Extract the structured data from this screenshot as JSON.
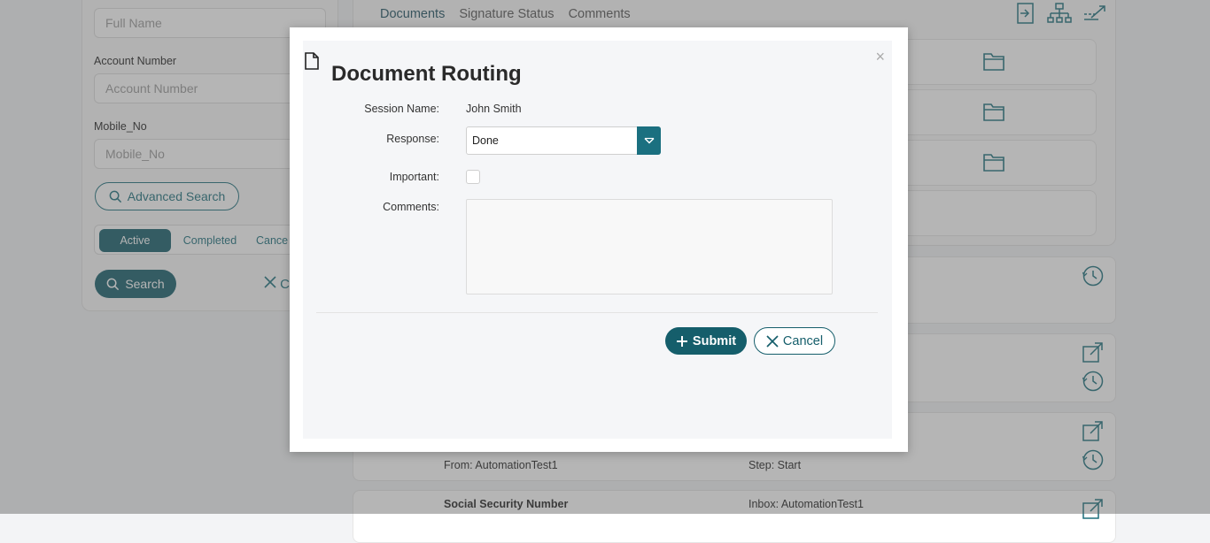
{
  "background": {
    "search_panel": {
      "full_name_placeholder": "Full Name",
      "account_number_label": "Account Number",
      "account_number_placeholder": "Account Number",
      "mobile_label": "Mobile_No",
      "mobile_placeholder": "Mobile_No",
      "advanced_search_label": "Advanced Search",
      "status_tabs": [
        "Active",
        "Completed",
        "Cance"
      ],
      "search_label": "Search",
      "clear_label": "C"
    },
    "tabs": [
      "Documents",
      "Signature Status",
      "Comments"
    ],
    "cards": {
      "from_text": "From: AutomationTest1",
      "step_text": "Step: Start",
      "ssn_text": "Social Security Number",
      "inbox_text": "Inbox: AutomationTest1"
    }
  },
  "modal": {
    "title": "Document Routing",
    "close_glyph": "×",
    "session_name_label": "Session Name:",
    "session_name_value": "John Smith",
    "response_label": "Response:",
    "response_value": "Done",
    "important_label": "Important:",
    "comments_label": "Comments:",
    "comments_value": "",
    "submit_label": "Submit",
    "cancel_label": "Cancel"
  },
  "colors": {
    "accent": "#155e6b",
    "select_button": "#1b7080"
  },
  "icons": [
    "document-icon",
    "search-icon",
    "close-icon",
    "plus-icon",
    "chevron-down-icon",
    "folder-icon",
    "history-icon",
    "open-external-icon",
    "import-icon",
    "org-chart-icon",
    "flow-icon"
  ]
}
